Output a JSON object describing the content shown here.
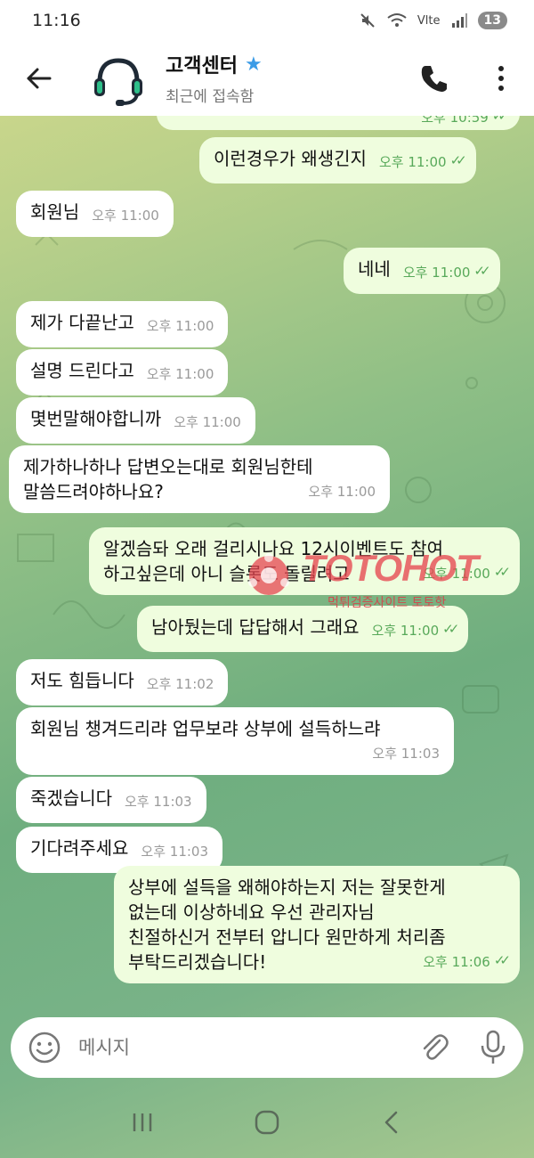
{
  "status_bar": {
    "time": "11:16",
    "network_label": "Vlte",
    "battery": "13"
  },
  "header": {
    "title": "고객센터",
    "subtitle": "최근에 접속함"
  },
  "partial_top_time": "오후 10:59",
  "messages": [
    {
      "dir": "out",
      "text": "이런경우가 왜생긴지",
      "time": "오후 11:00"
    },
    {
      "dir": "in",
      "text": "회원님",
      "time": "오후 11:00"
    },
    {
      "dir": "out",
      "text": "네네",
      "time": "오후 11:00"
    },
    {
      "dir": "in",
      "text": "제가 다끝난고",
      "time": "오후 11:00"
    },
    {
      "dir": "in",
      "text": "설명 드린다고",
      "time": "오후 11:00"
    },
    {
      "dir": "in",
      "text": "몇번말해야합니까",
      "time": "오후 11:00"
    },
    {
      "dir": "in",
      "lines": [
        "제가하나하나 답변오는대로 회원님한테",
        "말씀드려야하나요?"
      ],
      "time": "오후 11:00"
    },
    {
      "dir": "out",
      "lines": [
        "알겠슴돠 오래 걸리시나요 12시이벤트도 참여",
        "하고싶은데 아니 슬롯도 돌릴려고"
      ],
      "time": "오후 11:00"
    },
    {
      "dir": "out",
      "text": "남아뒀는데 답답해서 그래요",
      "time": "오후 11:00"
    },
    {
      "dir": "in",
      "text": "저도 힘듭니다",
      "time": "오후 11:02"
    },
    {
      "dir": "in",
      "lines": [
        "회원님 챙겨드리랴 업무보랴 상부에 설득하느랴"
      ],
      "time": "오후 11:03"
    },
    {
      "dir": "in",
      "text": "죽겠습니다",
      "time": "오후 11:03"
    },
    {
      "dir": "in",
      "text": "기다려주세요",
      "time": "오후 11:03"
    },
    {
      "dir": "out",
      "lines": [
        "상부에 설득을 왜해야하는지 저는 잘못한게",
        "없는데 이상하네요 우선 관리자님",
        "친절하신거 전부터 압니다 원만하게 처리좀",
        "부탁드리겠습니다!"
      ],
      "time": "오후 11:06"
    }
  ],
  "watermark": {
    "main": "TOTOHOT",
    "sub": "먹튀검증사이트 토토핫"
  },
  "input": {
    "placeholder": "메시지"
  },
  "icons": {
    "back": "arrow-left-icon",
    "avatar": "headset-icon",
    "verified": "star-icon",
    "call": "phone-icon",
    "menu": "more-vertical-icon",
    "emoji": "smiley-icon",
    "attach": "paperclip-icon",
    "mic": "microphone-icon",
    "nav_recent": "recent-apps-icon",
    "nav_home": "home-icon",
    "nav_back": "chevron-left-icon"
  },
  "colors": {
    "incoming_bubble": "#ffffff",
    "outgoing_bubble": "#effdde",
    "outgoing_time": "#58a95a",
    "star": "#3a9be6",
    "watermark": "#e64650"
  }
}
